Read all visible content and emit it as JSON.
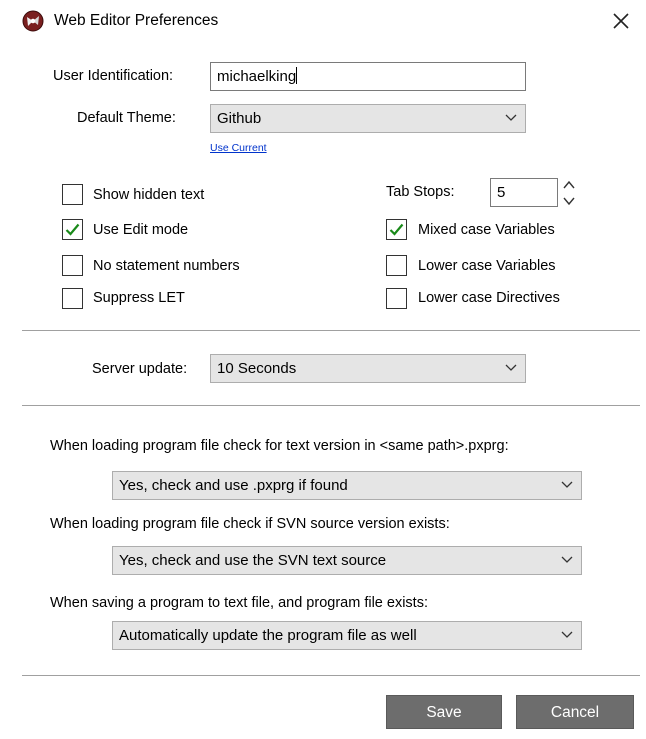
{
  "window": {
    "title": "Web Editor Preferences"
  },
  "user": {
    "label": "User Identification:",
    "value": "michaelking"
  },
  "theme": {
    "label": "Default Theme:",
    "value": "Github",
    "use_current": "Use Current"
  },
  "tab_stops": {
    "label": "Tab Stops:",
    "value": "5"
  },
  "options_left": [
    {
      "label": "Show hidden text",
      "checked": false
    },
    {
      "label": "Use Edit mode",
      "checked": true
    },
    {
      "label": "No statement numbers",
      "checked": false
    },
    {
      "label": "Suppress LET",
      "checked": false
    }
  ],
  "options_right": [
    {
      "label": "Mixed case Variables",
      "checked": true
    },
    {
      "label": "Lower case Variables",
      "checked": false
    },
    {
      "label": "Lower case Directives",
      "checked": false
    }
  ],
  "server_update": {
    "label": "Server update:",
    "value": "10 Seconds"
  },
  "loading_text": {
    "label": "When loading program file check for text version in <same path>.pxprg:",
    "value": "Yes, check and use .pxprg if found"
  },
  "loading_svn": {
    "label": "When loading program file check if SVN source version exists:",
    "value": "Yes, check and use the SVN text source"
  },
  "saving": {
    "label": "When saving a program to text file, and program file exists:",
    "value": "Automatically update the program file as well"
  },
  "buttons": {
    "save": "Save",
    "cancel": "Cancel"
  },
  "colors": {
    "check_green": "#1a8a1a",
    "button_gray": "#6d6d6d",
    "link_blue": "#0033cc"
  }
}
